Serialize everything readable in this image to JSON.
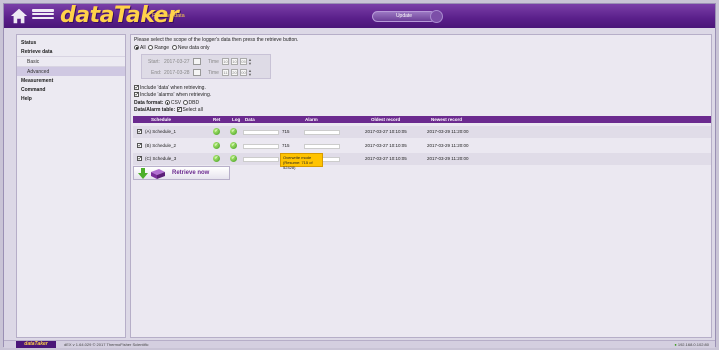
{
  "header": {
    "brand": "dataTaker",
    "subtitle": "Retrieve data",
    "update_label": "Update"
  },
  "sidebar": {
    "items": [
      {
        "label": "Status"
      },
      {
        "label": "Retrieve data"
      },
      {
        "label": "Basic"
      },
      {
        "label": "Advanced"
      },
      {
        "label": "Measurement"
      },
      {
        "label": "Command"
      },
      {
        "label": "Help"
      }
    ]
  },
  "main": {
    "instruction": "Please select the scope of the logger's data then press the retrieve button.",
    "scope": {
      "all": "All",
      "range": "Range",
      "new_only": "New data only"
    },
    "start": {
      "label": "Start:",
      "date": "2017-03-27",
      "time_label": "Time",
      "hh": "10",
      "mm": "10",
      "ss": "05"
    },
    "end": {
      "label": "End:",
      "date": "2017-03-28",
      "time_label": "Time",
      "hh": "11",
      "mm": "20",
      "ss": "00"
    },
    "include_data": "Include 'data' when retrieving.",
    "include_alarms": "Include 'alarms' when retrieving.",
    "data_format_label": "Data format:",
    "csv": "CSV",
    "dbd": "DBD",
    "table_label": "Data/Alarm table:",
    "select_all": "Select all",
    "table": {
      "headers": [
        "Schedule",
        "Ret",
        "Log",
        "Data",
        "Alarm",
        "Oldest record",
        "Newest record"
      ],
      "rows": [
        {
          "schedule": "(A) Schedule_1",
          "count": "715",
          "oldest": "2017-03-27 10:10:05",
          "newest": "2017-03-29 11:20:00"
        },
        {
          "schedule": "(B) Schedule_2",
          "count": "715",
          "oldest": "2017-03-27 10:10:05",
          "newest": "2017-03-29 11:20:00"
        },
        {
          "schedule": "(C) Schedule_3",
          "count": "",
          "oldest": "2017-03-27 10:10:05",
          "newest": "2017-03-29 11:20:00"
        }
      ]
    },
    "tooltip_line1": "Overwrite mode",
    "tooltip_line2": "(Resume: 715 of 52428)",
    "retrieve_label": "Retrieve now"
  },
  "footer": {
    "brand": "dataTaker",
    "version": "dEX v 1.64.029 © 2017 ThermoFisher Scientific",
    "ip": "192.168.0.102:80"
  },
  "colors": {
    "accent": "#6b2a8f",
    "brand_yellow": "#ffd24a",
    "tooltip": "#ffc300"
  }
}
